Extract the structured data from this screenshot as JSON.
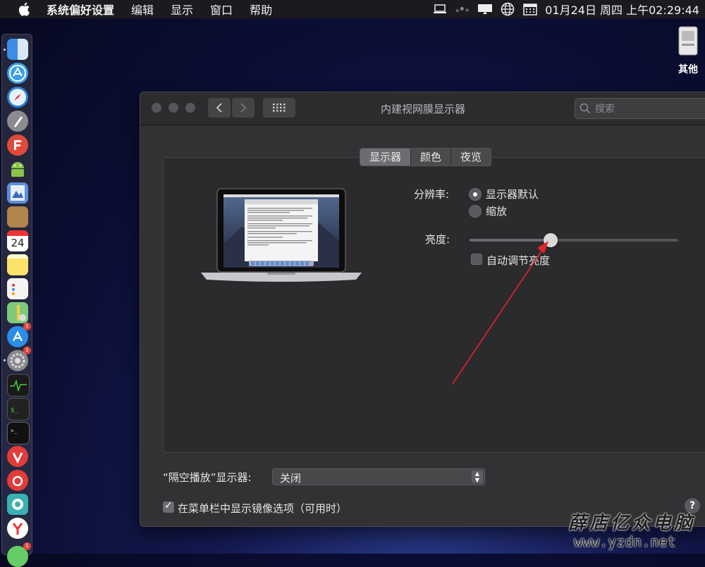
{
  "menubar": {
    "app_name": "系统偏好设置",
    "items": [
      "编辑",
      "显示",
      "窗口",
      "帮助"
    ],
    "clock": "01月24日 周四 上午02:29:44"
  },
  "desktop": {
    "icon_label": "其他"
  },
  "window": {
    "title": "内建视网膜显示器",
    "search_placeholder": "搜索",
    "tabs": [
      "显示器",
      "颜色",
      "夜览"
    ],
    "resolution_label": "分辨率:",
    "resolution_options": [
      "显示器默认",
      "缩放"
    ],
    "resolution_selected": "显示器默认",
    "brightness_label": "亮度:",
    "brightness_value": 0.39,
    "auto_brightness_label": "自动调节亮度",
    "auto_brightness_checked": false,
    "airplay_label": "“隔空播放”显示器:",
    "airplay_value": "关闭",
    "mirror_label": "在菜单栏中显示镜像选项（可用时）",
    "mirror_checked": true,
    "help": "?"
  },
  "dock": {
    "badges": [
      "1",
      "1",
      "1"
    ]
  },
  "watermark": {
    "line1": "薛店亿众电脑",
    "line2": "www.yzdn.net"
  },
  "colors": {
    "accent_arrow": "#e0242f",
    "window_bg": "#323235"
  }
}
